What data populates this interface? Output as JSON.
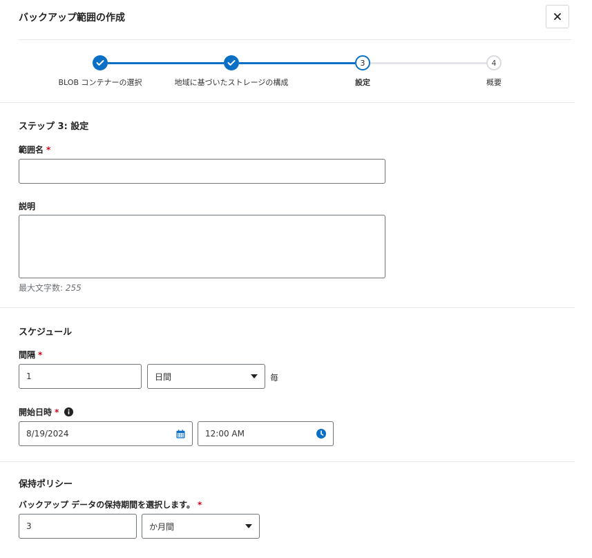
{
  "dialog": {
    "title": "バックアップ範囲の作成"
  },
  "stepper": {
    "steps": [
      {
        "number": "1",
        "label": "BLOB コンテナーの選択",
        "state": "done"
      },
      {
        "number": "2",
        "label": "地域に基づいたストレージの構成",
        "state": "done"
      },
      {
        "number": "3",
        "label": "設定",
        "state": "current"
      },
      {
        "number": "4",
        "label": "概要",
        "state": "future"
      }
    ]
  },
  "step_heading": "ステップ 3: 設定",
  "form": {
    "scope_name": {
      "label": "範囲名",
      "required_mark": "*",
      "value": ""
    },
    "description": {
      "label": "説明",
      "value": "",
      "hint_prefix": "最大文字数:",
      "hint_value": "255"
    },
    "schedule": {
      "section_title": "スケジュール",
      "interval_label": "間隔",
      "required_mark": "*",
      "interval_value": "1",
      "interval_unit": "日間",
      "interval_suffix": "毎",
      "start_label": "開始日時",
      "start_date": "8/19/2024",
      "start_time": "12:00 AM"
    },
    "retention": {
      "section_title": "保持ポリシー",
      "period_label": "バックアップ データの保持期間を選択します。",
      "required_mark": "*",
      "period_value": "3",
      "period_unit": "か月間"
    }
  },
  "colors": {
    "accent": "#0b6fc6",
    "required": "#d0021b",
    "inactive_line": "#e3e5e8"
  },
  "icons": [
    "close-icon",
    "check-icon",
    "info-icon",
    "calendar-icon",
    "clock-icon",
    "caret-down-icon"
  ]
}
